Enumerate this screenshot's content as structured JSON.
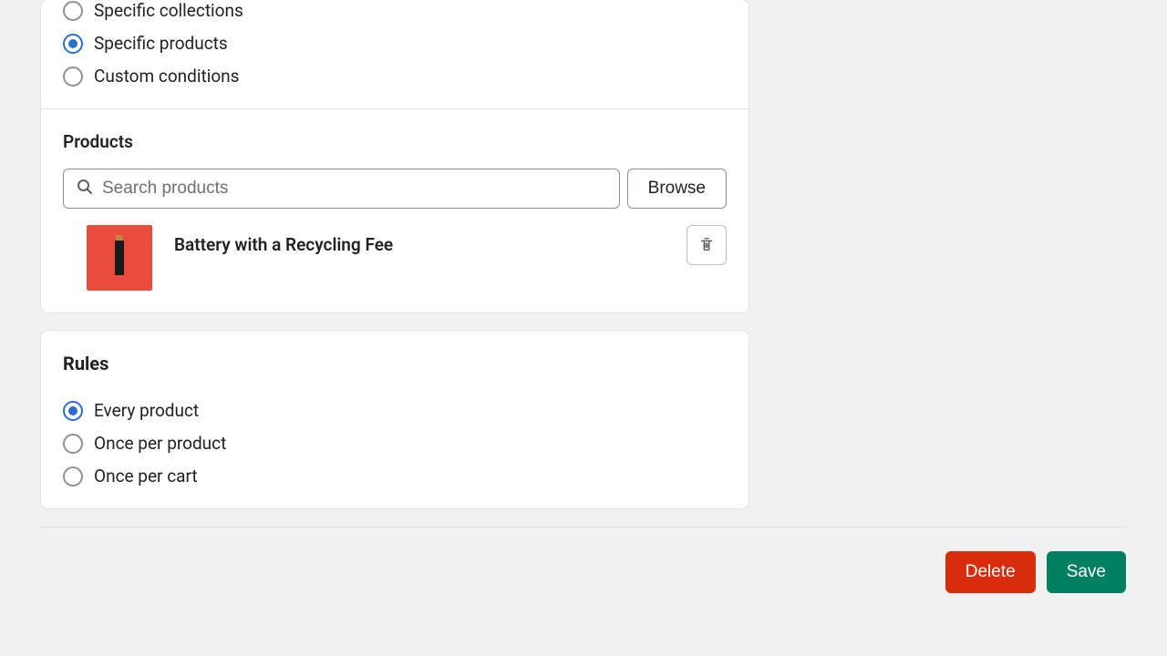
{
  "applyTo": {
    "options": [
      {
        "label": "Specific collections",
        "selected": false
      },
      {
        "label": "Specific products",
        "selected": true
      },
      {
        "label": "Custom conditions",
        "selected": false
      }
    ]
  },
  "products": {
    "title": "Products",
    "search_placeholder": "Search products",
    "browse_label": "Browse",
    "items": [
      {
        "name": "Battery with a Recycling Fee"
      }
    ]
  },
  "rules": {
    "title": "Rules",
    "options": [
      {
        "label": "Every product",
        "selected": true
      },
      {
        "label": "Once per product",
        "selected": false
      },
      {
        "label": "Once per cart",
        "selected": false
      }
    ]
  },
  "footer": {
    "delete_label": "Delete",
    "save_label": "Save"
  }
}
